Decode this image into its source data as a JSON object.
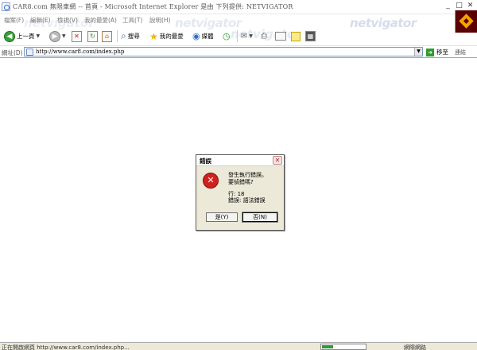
{
  "window": {
    "title": "CAR8.com 無限車網 -- 首頁 - Microsoft Internet Explorer 是由 下列提供: NETVIGATOR",
    "minimize_glyph": "_",
    "maximize_glyph": "□",
    "close_glyph": "✕"
  },
  "menu": {
    "items": [
      "檔案(F)",
      "編輯(E)",
      "檢視(V)",
      "我的最愛(A)",
      "工具(T)",
      "說明(H)"
    ],
    "brand": "netvigator"
  },
  "toolbar": {
    "back_label": "上一頁",
    "search_label": "搜尋",
    "favorites_label": "我的最愛",
    "media_label": "媒體"
  },
  "address": {
    "label": "網址(D)",
    "url": "http://www.car8.com/index.php",
    "go_label": "移至",
    "links_label": "連結"
  },
  "dialog": {
    "title": "錯誤",
    "message_line1": "發生執行錯誤。",
    "message_line2": "要偵錯嗎?",
    "line_label": "行: 18",
    "error_label": "錯誤: 語法錯誤",
    "yes_label": "是(Y)",
    "no_label": "否(N)"
  },
  "status": {
    "text": "正在開啟網頁 http://www.car8.com/index.php...",
    "progress_fraction": 0.25,
    "zone": "網際網路"
  },
  "colors": {
    "error_red": "#d0221c",
    "go_green": "#2e9b2e",
    "dialog_face": "#ece9d8"
  }
}
